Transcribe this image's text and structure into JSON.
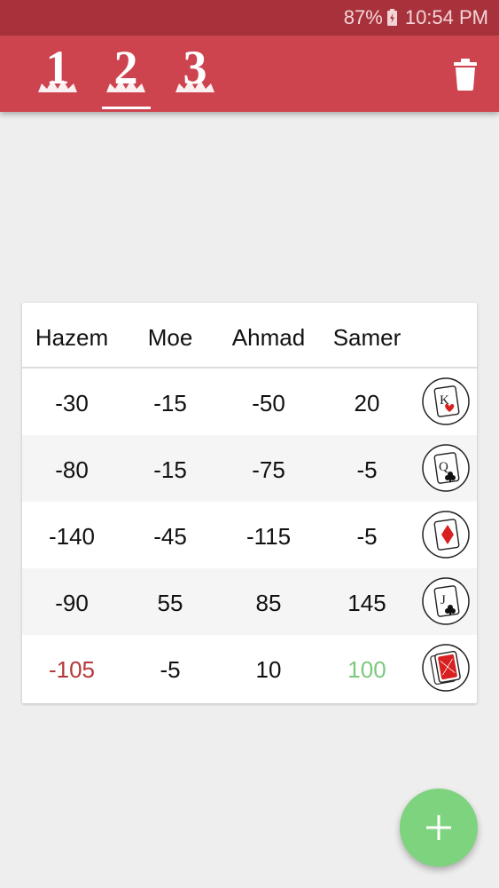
{
  "status_bar": {
    "battery": "87%",
    "time": "10:54 PM"
  },
  "app_bar": {
    "tabs": [
      {
        "label": "1"
      },
      {
        "label": "2"
      },
      {
        "label": "3"
      }
    ],
    "selected_tab": "2",
    "trash_icon": "trash-icon"
  },
  "table": {
    "headers": [
      "Hazem",
      "Moe",
      "Ahmad",
      "Samer"
    ],
    "rows": [
      {
        "values": [
          "-30",
          "-15",
          "-50",
          "20"
        ],
        "icon": "king-of-hearts-card"
      },
      {
        "values": [
          "-80",
          "-15",
          "-75",
          "-5"
        ],
        "icon": "queen-of-clubs-card"
      },
      {
        "values": [
          "-140",
          "-45",
          "-115",
          "-5"
        ],
        "icon": "diamond-card"
      },
      {
        "values": [
          "-90",
          "55",
          "85",
          "145"
        ],
        "icon": "jack-of-clubs-card"
      },
      {
        "values": [
          "-105",
          "-5",
          "10",
          "100"
        ],
        "icon": "card-back"
      }
    ]
  },
  "colors": {
    "status_bar": "#a8323c",
    "app_bar": "#cd444f",
    "fab": "#7dd37e",
    "lowest_score": "#b5383a",
    "highest_score": "#7cc87e"
  },
  "fab": {
    "icon": "plus-icon"
  }
}
